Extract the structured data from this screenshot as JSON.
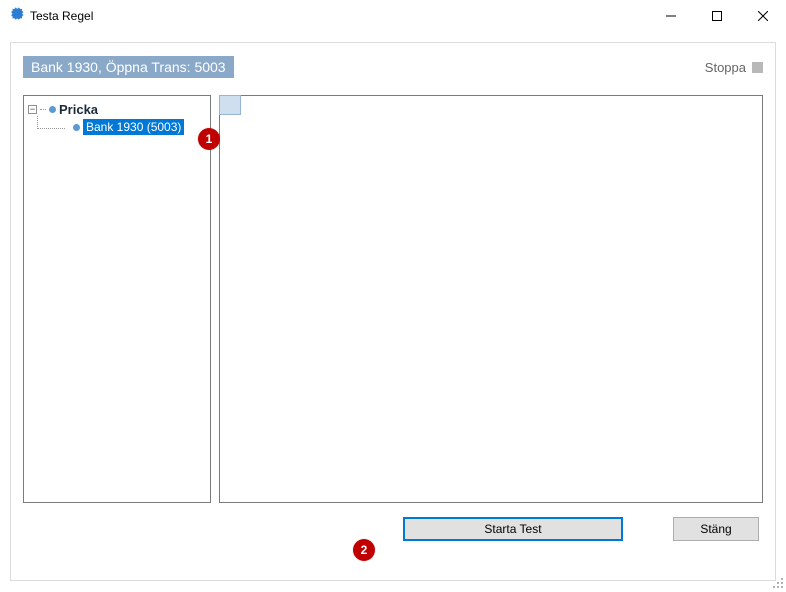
{
  "window": {
    "title": "Testa Regel"
  },
  "header": {
    "status": "Bank 1930, Öppna Trans: 5003",
    "stop_label": "Stoppa"
  },
  "tree": {
    "expander": "−",
    "root_label": "Pricka",
    "child_label": "Bank 1930 (5003)"
  },
  "footer": {
    "start_label": "Starta Test",
    "close_label": "Stäng"
  },
  "callouts": {
    "one": "1",
    "two": "2"
  }
}
